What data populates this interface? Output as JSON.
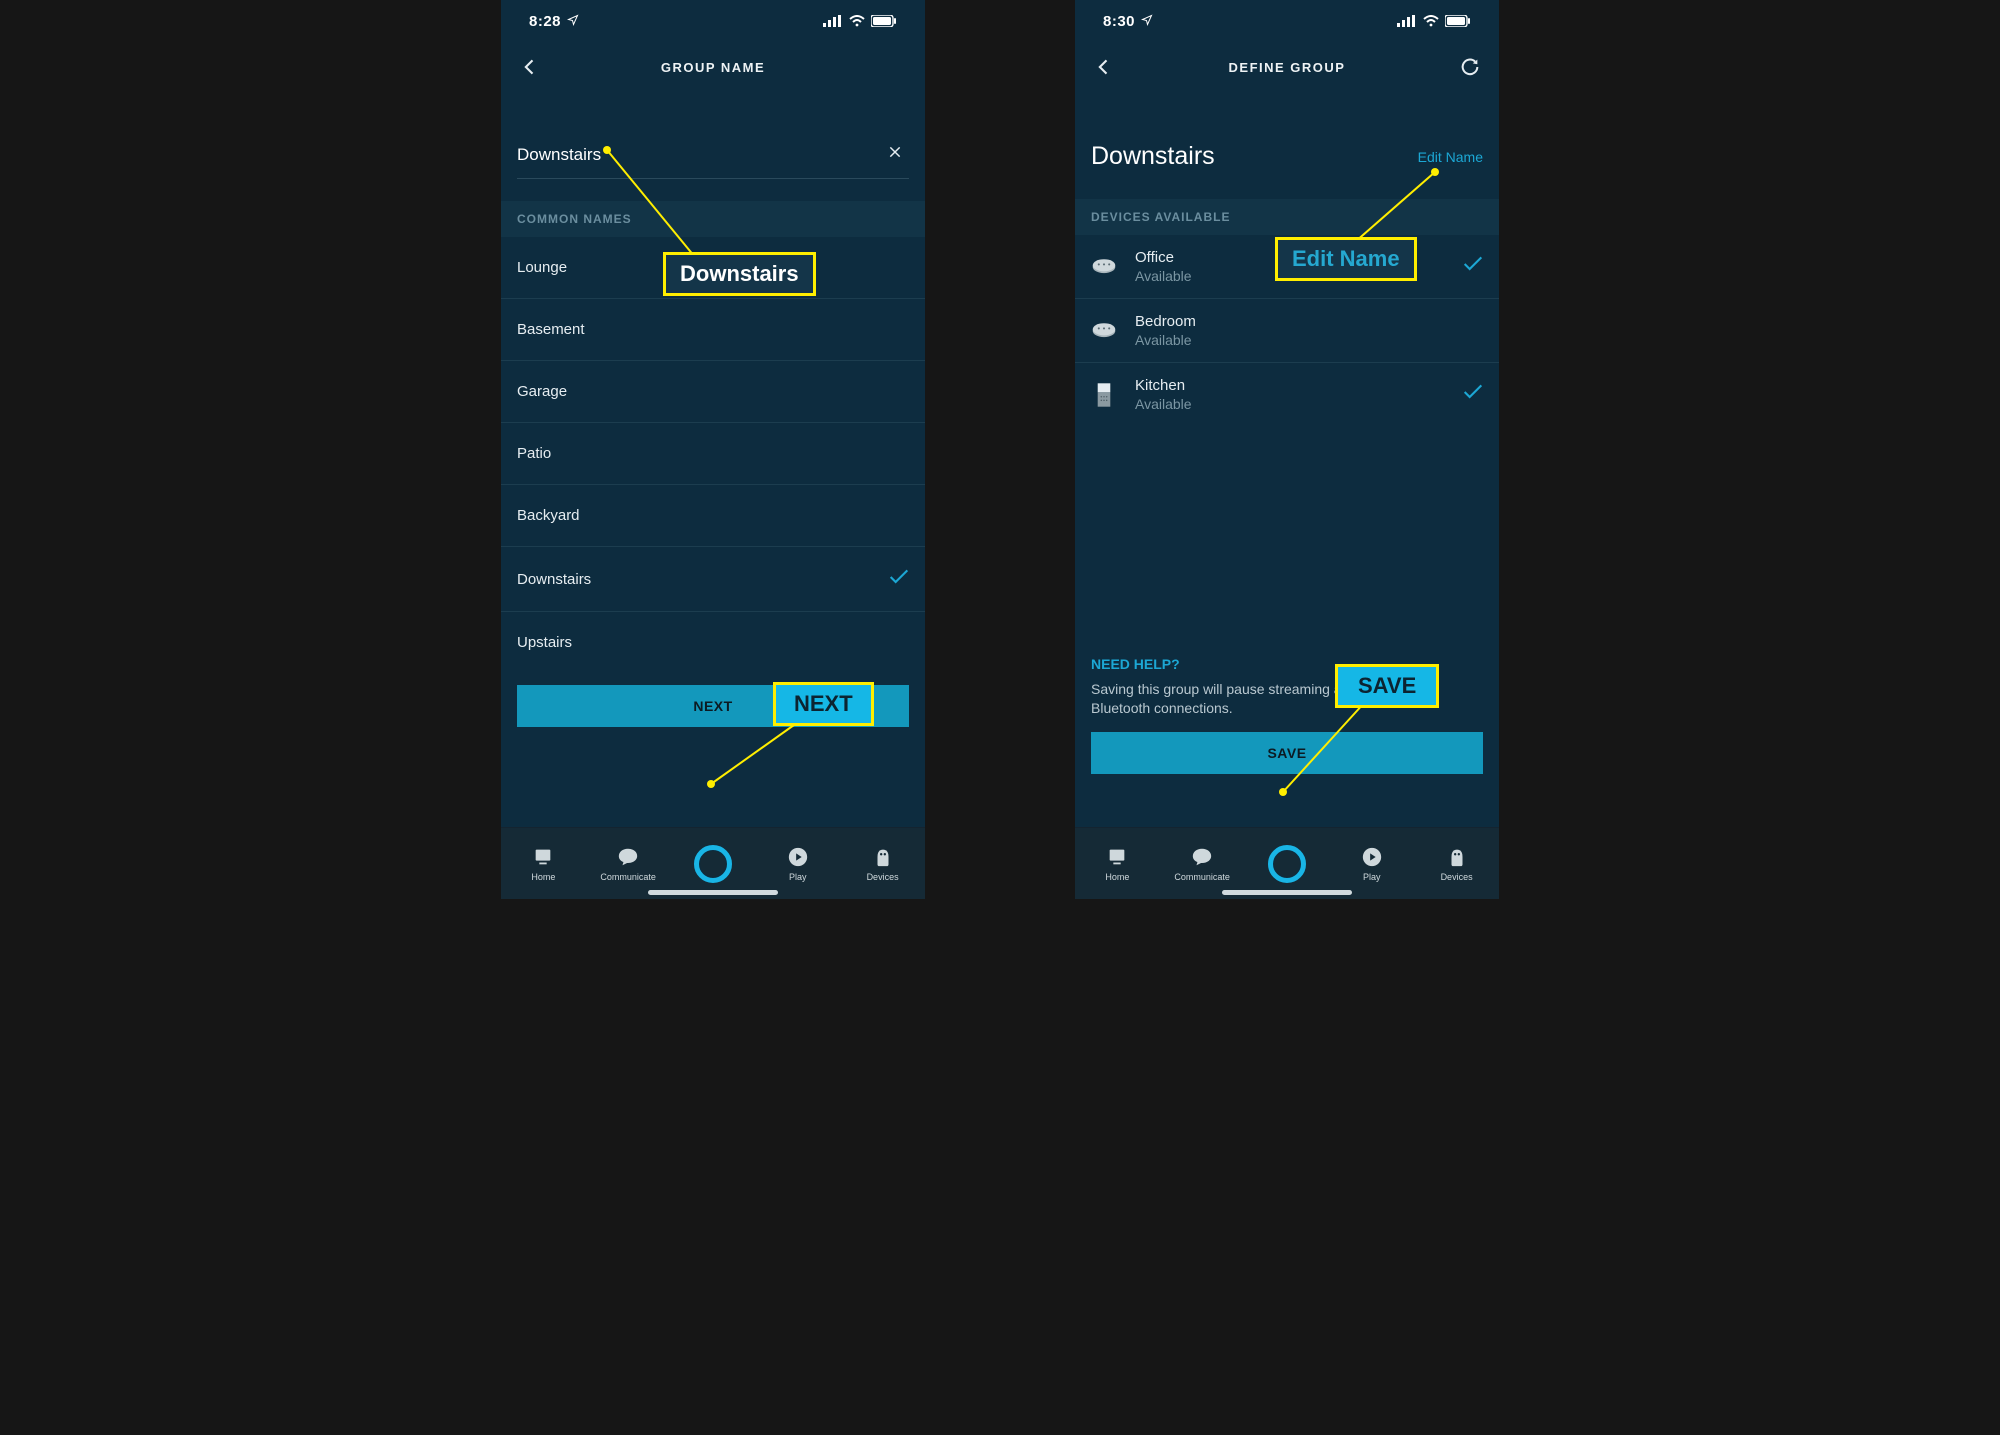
{
  "screenA": {
    "status": {
      "time": "8:28"
    },
    "nav": {
      "title": "GROUP NAME"
    },
    "input": {
      "value": "Downstairs"
    },
    "section_label": "COMMON NAMES",
    "options": [
      {
        "label": "Lounge",
        "selected": false
      },
      {
        "label": "Basement",
        "selected": false
      },
      {
        "label": "Garage",
        "selected": false
      },
      {
        "label": "Patio",
        "selected": false
      },
      {
        "label": "Backyard",
        "selected": false
      },
      {
        "label": "Downstairs",
        "selected": true
      },
      {
        "label": "Upstairs",
        "selected": false
      }
    ],
    "primary_button": "NEXT",
    "callouts": {
      "input": "Downstairs",
      "button": "NEXT"
    }
  },
  "screenB": {
    "status": {
      "time": "8:30"
    },
    "nav": {
      "title": "DEFINE GROUP"
    },
    "group_title": "Downstairs",
    "edit_link": "Edit Name",
    "section_label": "DEVICES AVAILABLE",
    "devices": [
      {
        "name": "Office",
        "status": "Available",
        "icon": "echo-dot",
        "selected": true
      },
      {
        "name": "Bedroom",
        "status": "Available",
        "icon": "echo-dot",
        "selected": false
      },
      {
        "name": "Kitchen",
        "status": "Available",
        "icon": "echo-show",
        "selected": true
      }
    ],
    "help": {
      "title": "NEED HELP?",
      "body": "Saving this group will pause streaming audio and active Bluetooth connections."
    },
    "primary_button": "SAVE",
    "callouts": {
      "edit": "Edit Name",
      "button": "SAVE"
    }
  },
  "footer": {
    "tabs": [
      {
        "label": "Home"
      },
      {
        "label": "Communicate"
      },
      {
        "label": ""
      },
      {
        "label": "Play"
      },
      {
        "label": "Devices"
      }
    ]
  }
}
